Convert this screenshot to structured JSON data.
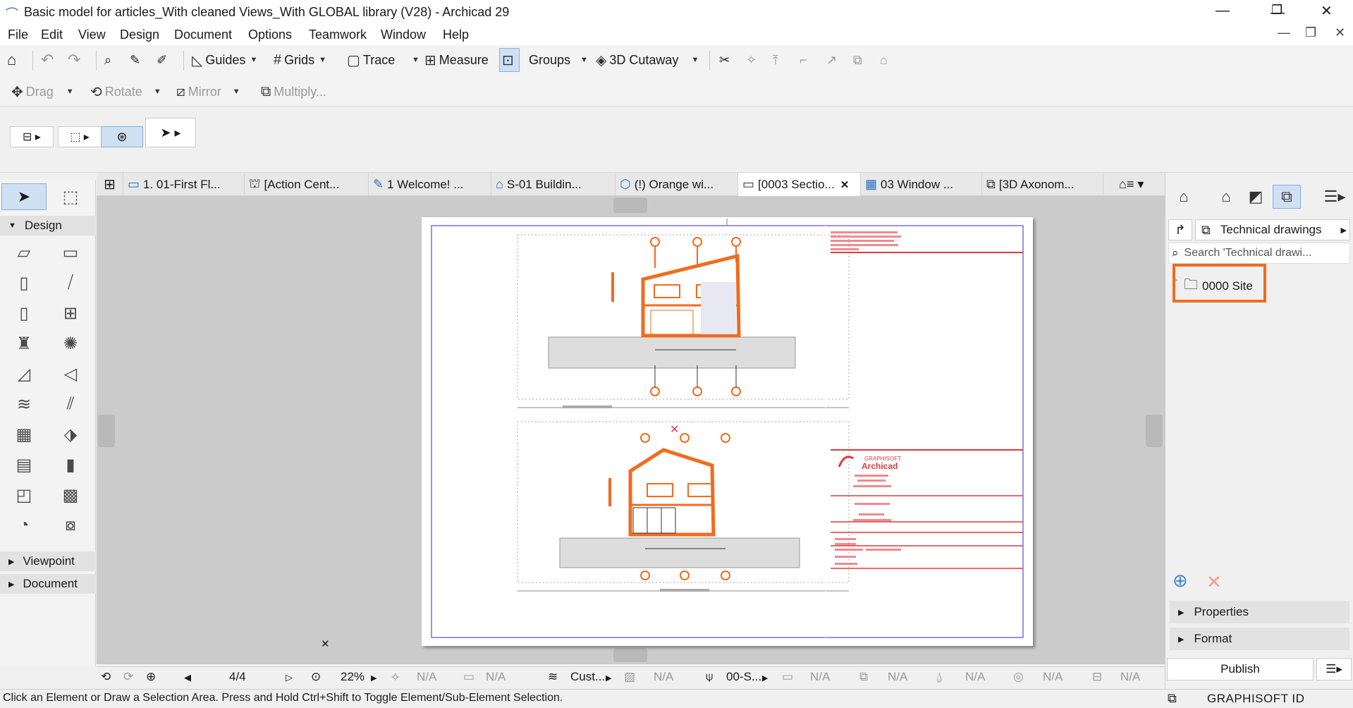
{
  "window": {
    "title": "Basic model for articles_With cleaned Views_With GLOBAL library (V28) - Archicad 29",
    "controls": [
      "—",
      "❐",
      "✕"
    ]
  },
  "menu": [
    "File",
    "Edit",
    "View",
    "Design",
    "Document",
    "Options",
    "Teamwork",
    "Window",
    "Help"
  ],
  "toolbar1": {
    "guides": "Guides",
    "grids": "Grids",
    "trace": "Trace",
    "measure": "Measure",
    "groups": "Groups",
    "cutaway": "3D Cutaway"
  },
  "toolbar2": {
    "drag": "Drag",
    "rotate": "Rotate",
    "mirror": "Mirror",
    "multiply": "Multiply..."
  },
  "toolbox": {
    "design": "Design",
    "viewpoint": "Viewpoint",
    "document": "Document"
  },
  "tabs": [
    {
      "label": "1. 01-First Fl...",
      "icon": "floor-plan-icon"
    },
    {
      "label": "[Action Cent...",
      "icon": "action-center-icon"
    },
    {
      "label": "1 Welcome! ...",
      "icon": "document-icon"
    },
    {
      "label": "S-01 Buildin...",
      "icon": "section-icon"
    },
    {
      "label": "(!) Orange wi...",
      "icon": "3d-icon"
    },
    {
      "label": "[0003 Sectio...",
      "icon": "layout-icon"
    },
    {
      "label": "03 Window ...",
      "icon": "schedule-icon"
    },
    {
      "label": "[3D Axonom...",
      "icon": "3d-document-icon"
    }
  ],
  "navigator": {
    "dropdown": "Technical drawings",
    "search_placeholder": "Search 'Technical drawi...",
    "tree_item": "0000 Site",
    "properties": "Properties",
    "format": "Format",
    "publish": "Publish",
    "brand": "GRAPHISOFT ID"
  },
  "navbar": {
    "page": "4/4",
    "zoom": "22%",
    "na": "N/A",
    "custom": "Cust...",
    "scale": "00-S..."
  },
  "statusbar": {
    "message": "Click an Element or Draw a Selection Area. Press and Hold Ctrl+Shift to Toggle Element/Sub-Element Selection."
  },
  "titleblock": {
    "brand_small": "GRAPHISOFT",
    "brand": "Archicad"
  },
  "colors": {
    "accent": "#f26b1d",
    "selection": "#3f86d9",
    "red": "#e0393e"
  }
}
